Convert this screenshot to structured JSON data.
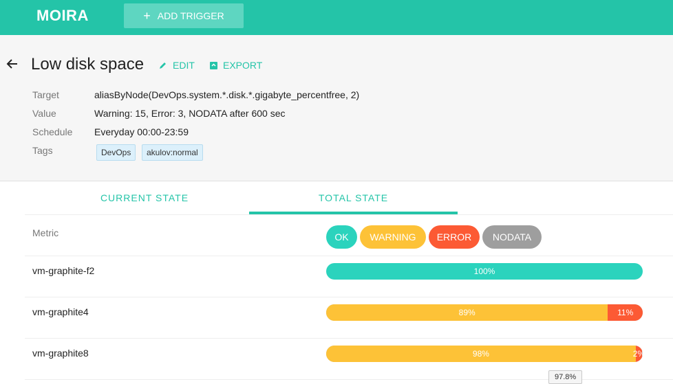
{
  "header": {
    "logo_text": "MOIRA",
    "add_trigger_label": "ADD TRIGGER",
    "brand_color": "#24c4a8"
  },
  "trigger": {
    "title": "Low disk space",
    "edit_label": "EDIT",
    "export_label": "EXPORT",
    "fields": [
      {
        "label": "Target",
        "value": "aliasByNode(DevOps.system.*.disk.*.gigabyte_percentfree, 2)"
      },
      {
        "label": "Value",
        "value": "Warning: 15, Error: 3, NODATA after 600 sec"
      },
      {
        "label": "Schedule",
        "value": "Everyday 00:00-23:59"
      },
      {
        "label": "Tags",
        "value": ""
      }
    ],
    "tags": [
      "DevOps",
      "akulov:normal"
    ]
  },
  "tabs": {
    "current": "CURRENT STATE",
    "total": "TOTAL STATE",
    "active": "total"
  },
  "table": {
    "metric_header": "Metric",
    "states": [
      "OK",
      "WARNING",
      "ERROR",
      "NODATA"
    ],
    "state_colors": {
      "ok": "#2bd3bd",
      "warning": "#fdc237",
      "error": "#fc5a34",
      "nodata": "#9e9e9e"
    },
    "rows": [
      {
        "name": "vm-graphite-f2",
        "ok": 100,
        "warning": 0,
        "error": 0,
        "ok_label": "100%",
        "warning_label": "",
        "error_label": ""
      },
      {
        "name": "vm-graphite4",
        "ok": 0,
        "warning": 89,
        "error": 11,
        "ok_label": "",
        "warning_label": "89%",
        "error_label": "11%"
      },
      {
        "name": "vm-graphite8",
        "ok": 0,
        "warning": 97.8,
        "error": 2,
        "ok_label": "",
        "warning_label": "98%",
        "error_label": "2%"
      }
    ]
  },
  "tooltip": "97.8%"
}
